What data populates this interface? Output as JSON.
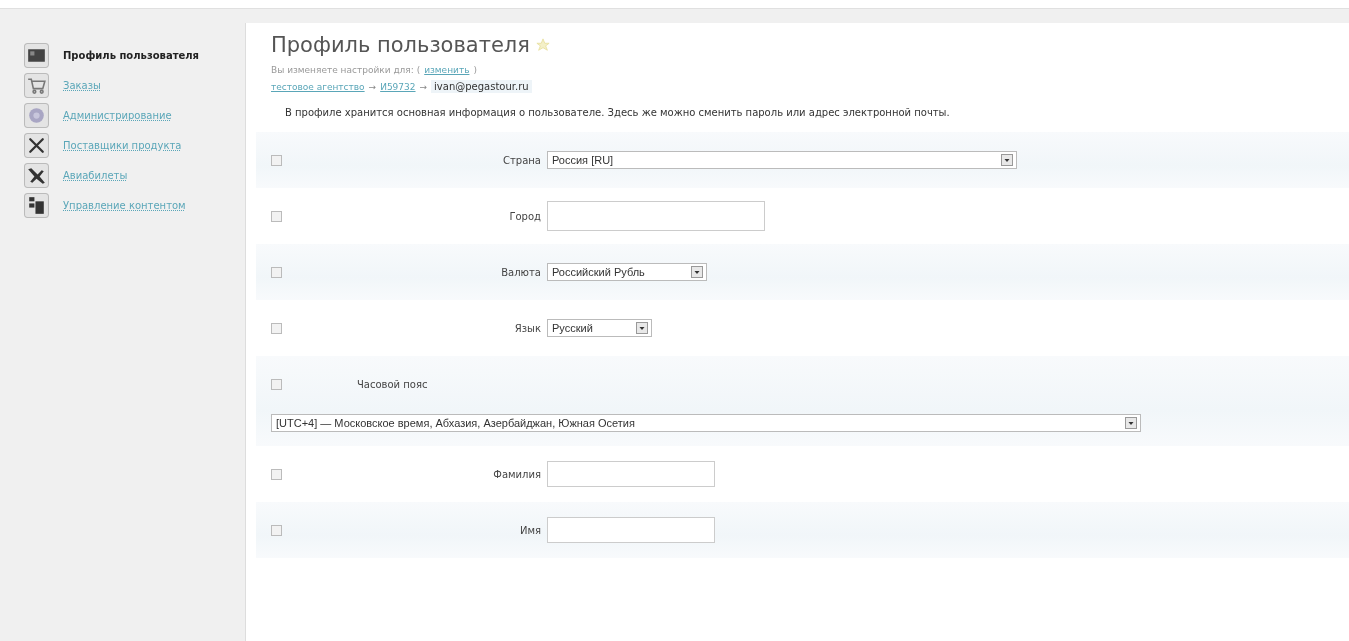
{
  "sidebar": {
    "items": [
      {
        "label": "Профиль пользователя",
        "selected": true
      },
      {
        "label": "Заказы",
        "selected": false
      },
      {
        "label": "Администрирование",
        "selected": false
      },
      {
        "label": "Поставщики продукта",
        "selected": false
      },
      {
        "label": "Авиабилеты",
        "selected": false
      },
      {
        "label": "Управление контентом",
        "selected": false
      }
    ]
  },
  "page": {
    "title": "Профиль пользователя",
    "editing_for": "Вы изменяете настройки для: (",
    "change_link": "изменить",
    "close_paren": ")",
    "breadcrumb": [
      {
        "text": "тестовое агентство",
        "kind": "link"
      },
      {
        "text": "И59732",
        "kind": "link"
      },
      {
        "text": "ivan@pegastour.ru",
        "kind": "current"
      }
    ],
    "arrow": "→",
    "description": "В профиле хранится основная информация о пользователе. Здесь же можно сменить пароль или адрес электронной почты."
  },
  "fields": [
    {
      "kind": "select",
      "label": "Страна",
      "value": "Россия [RU]",
      "checked": false
    },
    {
      "kind": "text",
      "label": "Город",
      "checked": false
    },
    {
      "kind": "select",
      "label": "Валюта",
      "value": "Российский Рубль",
      "checked": false
    },
    {
      "kind": "select",
      "label": "Язык",
      "value": "Русский",
      "checked": false
    },
    {
      "kind": "select-below",
      "label": "Часовой пояс",
      "value": "[UTC+4] — Московское время, Абхазия, Азербайджан, Южная Осетия",
      "checked": false
    },
    {
      "kind": "text",
      "label": "Фамилия",
      "checked": false
    },
    {
      "kind": "text",
      "label": "Имя",
      "checked": false
    }
  ]
}
